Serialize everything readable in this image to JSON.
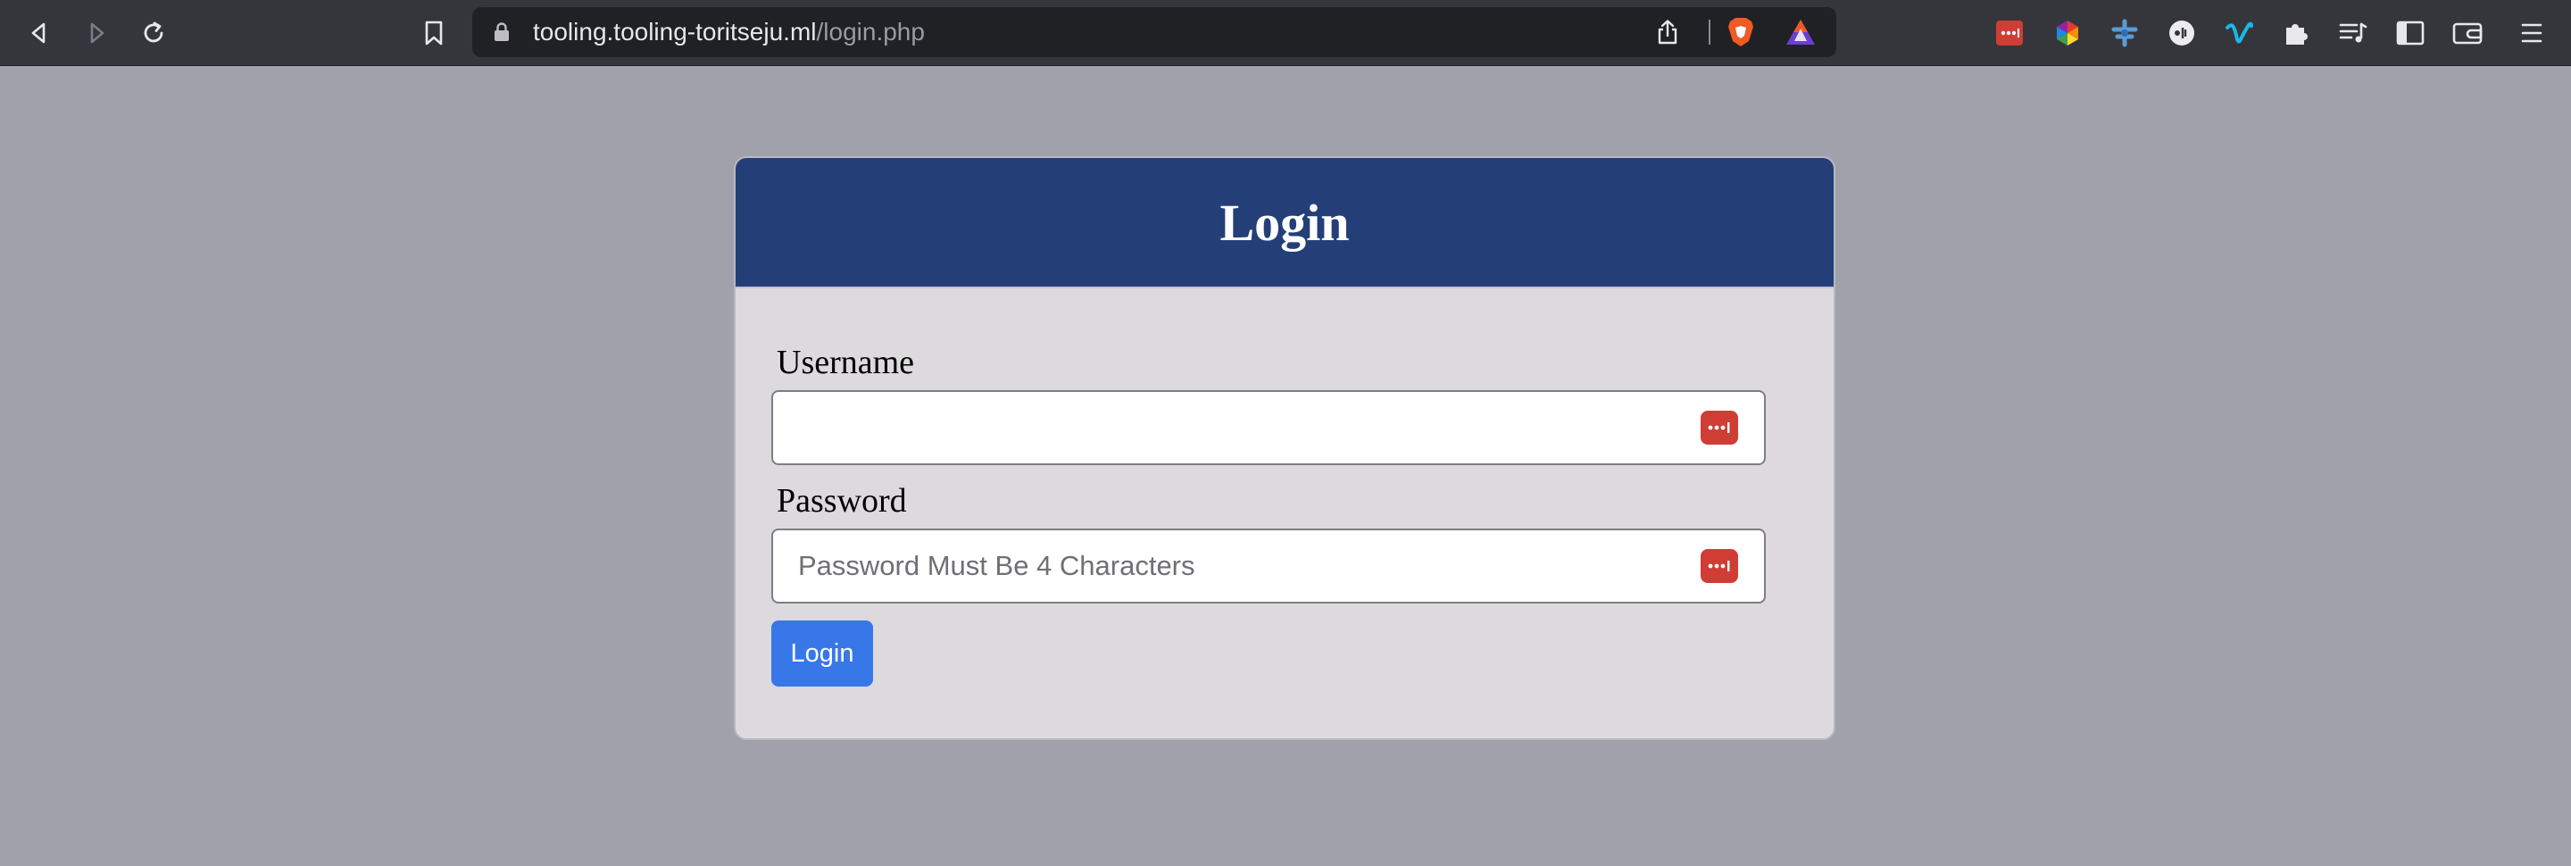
{
  "browser": {
    "url_host": "tooling.tooling-toritseju.ml",
    "url_path": "/login.php",
    "icons": {
      "back": "back-arrow-icon",
      "forward": "forward-arrow-icon",
      "reload": "reload-icon",
      "bookmark": "bookmark-icon",
      "lock": "lock-icon",
      "share": "share-icon",
      "brave_shields": "brave-shields-icon",
      "brave_rewards": "brave-rewards-icon"
    },
    "extensions": [
      "password-manager-extension-icon",
      "color-picker-extension-icon",
      "blue-extension-icon",
      "circle-extension-icon",
      "vimeo-extension-icon",
      "puzzle-extensions-icon",
      "playlist-icon",
      "sidebar-icon",
      "wallet-icon",
      "menu-icon"
    ]
  },
  "login": {
    "title": "Login",
    "username_label": "Username",
    "username_value": "",
    "password_label": "Password",
    "password_placeholder": "Password Must Be 4 Characters",
    "submit_label": "Login"
  },
  "colors": {
    "page_background": "#a0a1ab",
    "header_background": "#243f78",
    "card_background": "#dcdadc",
    "button_background": "#3777e8",
    "password_icon_red": "#cf3d34"
  }
}
